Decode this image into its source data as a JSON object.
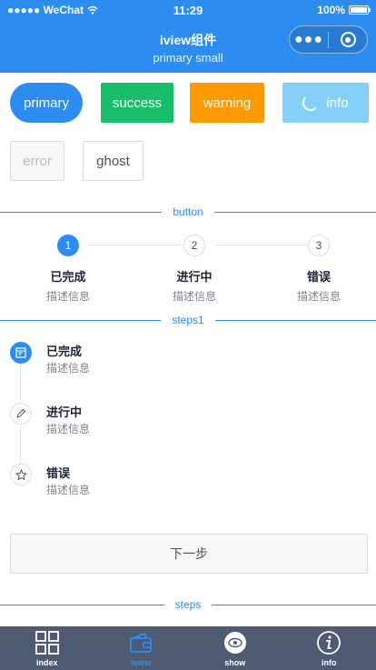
{
  "status_bar": {
    "signal": "●●●●● WeChat",
    "time": "11:29",
    "battery": "100%"
  },
  "nav": {
    "title": "iview组件",
    "underlay": "primary small",
    "menu": "●●●"
  },
  "buttons": {
    "primary": "primary",
    "success": "success",
    "warning": "warning",
    "info": "info",
    "error": "error",
    "ghost": "ghost"
  },
  "dividers": {
    "button": "button",
    "steps1": "steps1",
    "steps": "steps"
  },
  "steps_horizontal": [
    {
      "num": "1",
      "title": "已完成",
      "desc": "描述信息"
    },
    {
      "num": "2",
      "title": "进行中",
      "desc": "描述信息"
    },
    {
      "num": "3",
      "title": "错误",
      "desc": "描述信息"
    }
  ],
  "steps_vertical": [
    {
      "title": "已完成",
      "desc": "描述信息",
      "icon": "document-icon"
    },
    {
      "title": "进行中",
      "desc": "描述信息",
      "icon": "edit-icon"
    },
    {
      "title": "错误",
      "desc": "描述信息",
      "icon": "star-icon"
    }
  ],
  "next_button": "下一步",
  "tabbar": [
    {
      "label": "index",
      "icon": "grid-icon"
    },
    {
      "label": "iview",
      "icon": "wallet-icon",
      "active": true
    },
    {
      "label": "show",
      "icon": "eye-icon"
    },
    {
      "label": "info",
      "icon": "info-icon"
    }
  ],
  "colors": {
    "primary": "#2d8cf0",
    "success": "#19be6b",
    "warning": "#ff9900",
    "info": "#85d0f8",
    "tabbar": "#4f5b72"
  }
}
